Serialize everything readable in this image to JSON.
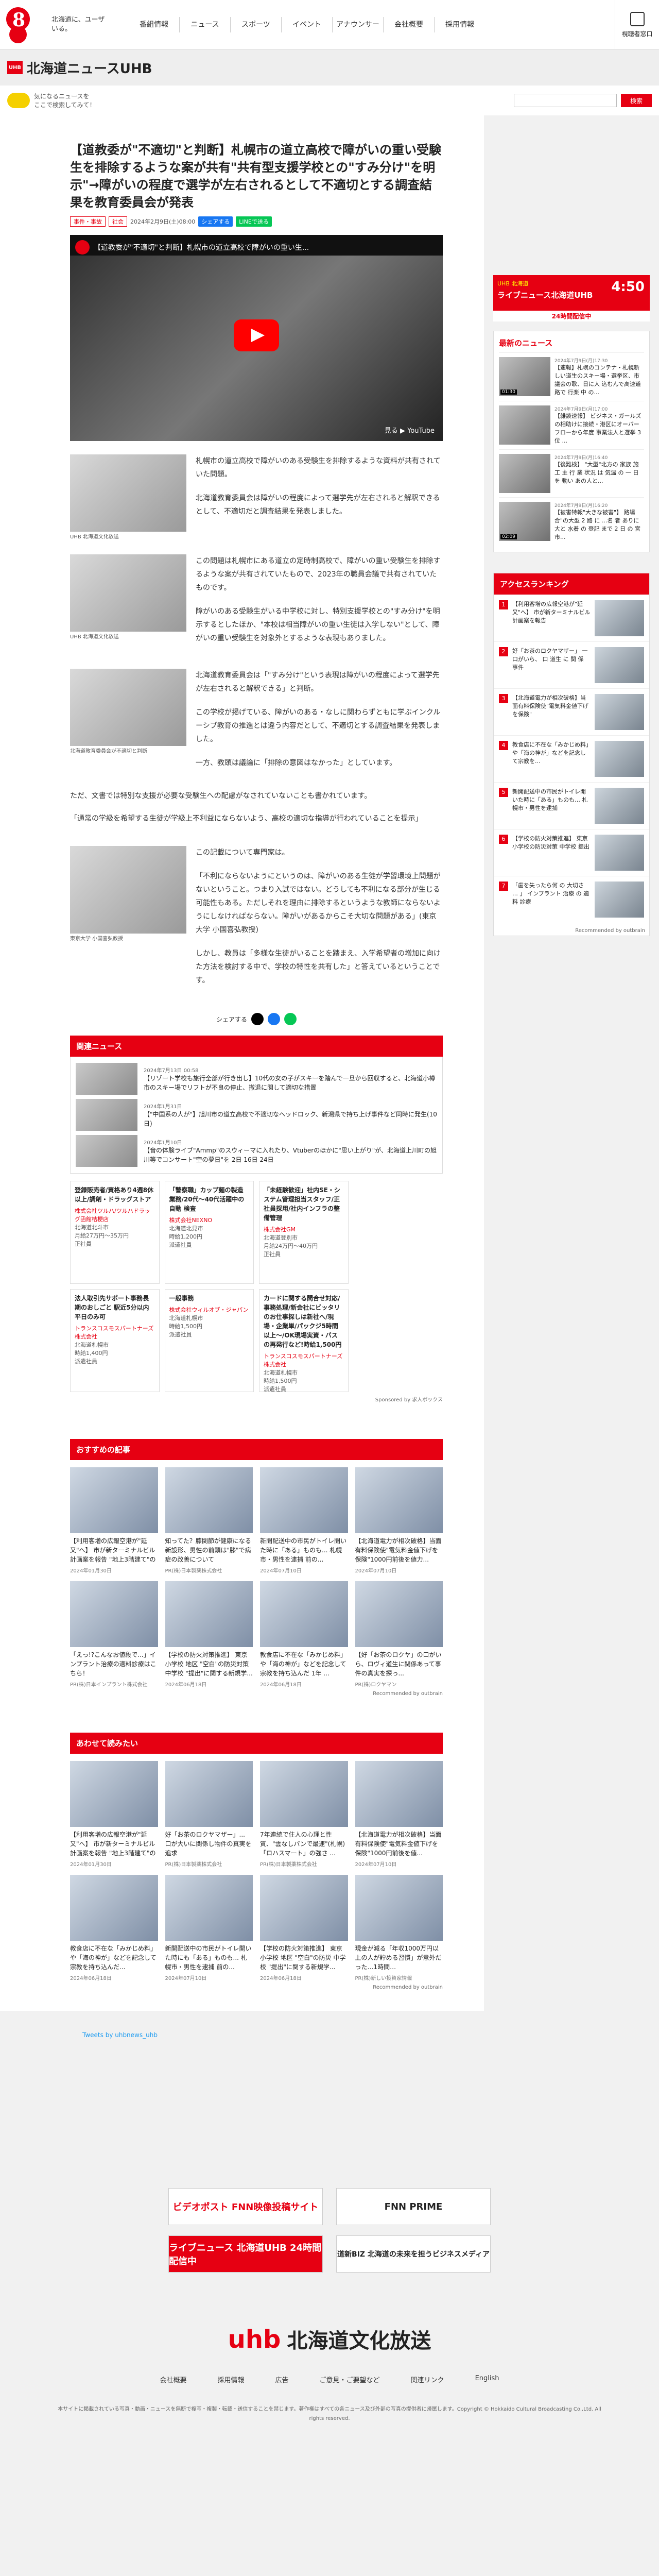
{
  "header": {
    "tagline": "北海道に、ユーザいる。",
    "nav": [
      "番組情報",
      "ニュース",
      "スポーツ",
      "イベント",
      "アナウンサー",
      "会社概要",
      "採用情報"
    ],
    "access": "視聴者窓口"
  },
  "brand": {
    "logo_box": "UHB",
    "name": "北海道ニュースUHB"
  },
  "search": {
    "kicker": "気になるニュースを\nここで検索してみて！",
    "placeholder": "",
    "button": "検索"
  },
  "article": {
    "title": "【道教委が\"不適切\"と判断】札幌市の道立高校で障がいの重い受験生を排除するような案が共有\"共有型支援学校との\"すみ分け\"を明示\"→障がいの程度で選学が左右されるとして不適切とする調査結果を教育委員会が発表",
    "tags": [
      "事件・事故",
      "社会"
    ],
    "date": "2024年2月9日(土)08:00",
    "fb": "シェアする",
    "ln": "LINEで送る",
    "video_title": "【道教委が\"不適切\"と判断】札幌市の道立高校で障がいの重い生...",
    "video_channel": "北海道ニュースUHB",
    "video_footer": "見る ▶ YouTube",
    "blocks": [
      {
        "caption": "UHB 北海道文化放送",
        "paras": [
          "札幌市の道立高校で障がいのある受験生を排除するような資料が共有されていた問題。",
          "北海道教育委員会は障がいの程度によって選学先が左右されると解釈できるとして、不適切だと調査結果を発表しました。"
        ]
      },
      {
        "caption": "UHB 北海道文化放送",
        "paras": [
          "この問題は札幌市にある道立の定時制高校で、障がいの重い受験生を排除するような案が共有されていたもので、2023年の職員会議で共有されていたものです。",
          "障がいのある受験生がいる中学校に対し、特別支援学校との\"すみ分け\"を明示するとしたほか、\"本校は相当障がいの重い生徒は入学しない\"として、障がいの重い受験生を対象外とするような表現もありました。"
        ]
      },
      {
        "caption": "北海道教育委員会が不適切と判断",
        "paras": [
          "北海道教育委員会は「\"すみ分け\"という表現は障がいの程度によって選学先が左右されると解釈できる」と判断。",
          "この学校が掲げている、障がいのある・なしに関わらずともに学ぶインクルーシブ教育の推進とは違う内容だとして、不適切とする調査結果を発表しました。",
          "一方、教頭は議論に「排除の意図はなかった」としています。"
        ]
      }
    ],
    "p1": "ただ、文書では特別な支援が必要な受験生への配慮がなされていないことも書かれています。",
    "p2": "「通常の学級を希望する生徒が学級上不利益にならないよう、高校の適切な指導が行われていることを提示」",
    "expert_caption": "東京大学 小国喜弘教授",
    "expert_paras": [
      "この記載について専門家は。",
      "「不利にならないようにというのは、障がいのある生徒が学習環境上問題がないということ。つまり入試ではない。どうしても不利になる部分が生じる可能性もある。ただしそれを理由に排除するというような教師にならないようにしなければならない。障がいがあるからこそ大切な問題がある」(東京大学 小国喜弘教授)",
      "しかし、教員は「多様な生徒がいることを踏まえ、入学希望者の増加に向けた方法を検討する中で、学校の特性を共有した」と答えているということです。"
    ],
    "share": "シェアする"
  },
  "related": {
    "title": "関連ニュース",
    "items": [
      {
        "date": "2024年7月13日 00:58",
        "text": "【リゾート学校も旅行全部が行き出し】10代の女の子がスキーを踏んで一旦から回収すると、北海道小樽市のスキー場でリフトが不良の停止、撤退に関して適切な措置"
      },
      {
        "date": "2024年1月31日",
        "text": "【\"中国系の人が\"】旭川市の道立高校で不適切なヘッドロック、新潟県で持ち上げ事件など同時に発生(10日)"
      },
      {
        "date": "2024年1月10日",
        "text": "【音の体験ライブ\"Ammp\"のスウィーマに入れたり、Vtuberのほかに\"思い上がり\"が、北海道上川町の旭川等でコンサート\"空の夢日\"を 2日 16日 24日"
      }
    ]
  },
  "jobs": [
    {
      "head": "登録販売者/資格あり4週8休以上/調剤・ドラッグストア",
      "co": "株式会社ツルハ/ツルハドラッグ函館桔梗店",
      "area": "北海道北斗市",
      "pay": "月給27万円〜35万円",
      "misc": "正社員"
    },
    {
      "head": "「警察職」カップ麺の製造業務/20代〜40代活躍中の自動 検査",
      "co": "株式会社NEXNO",
      "area": "北海道北見市",
      "pay": "時給1,200円",
      "misc": "派遣社員"
    },
    {
      "head": "「未経験歓迎」社内SE・システム管理担当スタッフ/正社員採用/社内インフラの整備管理",
      "co": "株式会社GM",
      "area": "北海道登別市",
      "pay": "月給24万円〜40万円",
      "misc": "正社員"
    },
    {
      "head": "",
      "co": "",
      "area": "",
      "pay": "",
      "misc": ""
    },
    {
      "head": "法人取引先サポート事務長期のおしごと 駅近5分以内 平日のみ可",
      "co": "トランスコスモスパートナーズ株式会社",
      "area": "北海道札幌市",
      "pay": "時給1,400円",
      "misc": "派遣社員"
    },
    {
      "head": "一般事務",
      "co": "株式会社ウィルオブ・ジャパン",
      "area": "北海道札幌市",
      "pay": "時給1,500円",
      "misc": "派遣社員"
    },
    {
      "head": "カードに関する問合せ対応/事務処理/新会社にビッタリのお仕事探しは新社へ/現場・企業単/パックジ5時間以上〜/OK現場実資・バスの再発行など!時給1,500円",
      "co": "トランスコスモスパートナーズ株式会社",
      "area": "北海道札幌市",
      "pay": "時給1,500円",
      "misc": "派遣社員"
    },
    {
      "head": "",
      "co": "",
      "area": "",
      "pay": "",
      "misc": ""
    }
  ],
  "jobs_sponsor": "Sponsored by 求人ボックス",
  "recommended": {
    "title": "おすすめの記事",
    "items": [
      {
        "t": "【利用客増の広報空港が\"延又\"へ】 市が新ターミナルビル計画案を報告 \"地上3階建て\"の新...",
        "s": "2024年01月30日"
      },
      {
        "t": "知ってた？膝関節が健康になる新設形、男性の前頭は\"膝\"で病症の改善について",
        "s": "PR(株)日本製薬株式会社"
      },
      {
        "t": "新開配送中の市民がトイレ開いた時に「ある」ものも... 札幌市・男性を逮捕 前の...",
        "s": "2024年07月10日"
      },
      {
        "t": "【北海道電力が相次破格】当面有料保険使\"電気料金値下げを保険\"1000円前後を値力...",
        "s": "2024年07月10日"
      },
      {
        "t": "「えっ!?こんなお値段で...」インプラント治療の適料診療はこちら！",
        "s": "PR(株)日本インプラント株式会社"
      },
      {
        "t": "【学校の防火対策推進】 東京小学校 地区 \"空白\"の防災対策 中学校 \"提出\"に関する新規学...",
        "s": "2024年06月18日"
      },
      {
        "t": "教食店に不在な「みかじめ料」や「海の神が」などを記念して宗教を持ち込んだ 1年 ...",
        "s": "2024年06月18日"
      },
      {
        "t": "【好「お茶のロクヤ」の口がいら、ロヴィ道生に関係あって事件の真実を探っ...",
        "s": "PR(株)ロクヤマン"
      }
    ],
    "sponsor": "Recommended by outbrain"
  },
  "readalso": {
    "title": "あわせて読みたい",
    "items": [
      {
        "t": "【利用客増の広報空港が\"延又\"へ】 市が新ターミナルビル計画案を報告 \"地上3階建て\"の新...",
        "s": "2024年01月30日"
      },
      {
        "t": "好「お茶のロクヤマザー」... 口が大いに関係し物件の真実を追求",
        "s": "PR(株)日本製薬株式会社"
      },
      {
        "t": "7年連続で住人の心理と性質、\"雲なしパンで最速\"(札幌)「ロハスマート」の強さ ...",
        "s": "PR(株)日本製薬株式会社"
      },
      {
        "t": "【北海道電力が相次破格】当面有料保険使\"電気料金値下げを保険\"1000円前後を値...",
        "s": "2024年07月10日"
      },
      {
        "t": "教食店に不在な「みかじめ料」や「海の神が」などを記念して宗教を持ち込んだ...",
        "s": "2024年06月18日"
      },
      {
        "t": "新開配送中の市民がトイレ開いた時にも「ある」ものも... 札幌市・男性を逮捕 前の...",
        "s": "2024年07月10日"
      },
      {
        "t": "【学校の防火対策推進】 東京小学校 地区 \"空白\"の防災 中学校 \"提出\"に関する新規学...",
        "s": "2024年06月18日"
      },
      {
        "t": "現金が減る「年収1000万円以上の人が貯める習慣」が意外だった…1時間…",
        "s": "PR(株)新しい投資家情報"
      }
    ],
    "sponsor": "Recommended by outbrain"
  },
  "twitter": "Tweets by uhbnews_uhb",
  "bottom_banners": [
    "ビデオポスト FNN映像投稿サイト",
    "FNN PRIME",
    "ライブニュース 北海道UHB 24時間配信中",
    "道新BIZ 北海道の未来を担うビジネスメディア"
  ],
  "footer": {
    "logo": "uhb",
    "logo_text": "北海道文化放送",
    "nav": [
      "会社概要",
      "採用情報",
      "広告",
      "ご意見・ご要望など",
      "関連リンク",
      "English"
    ],
    "small": "本サイトに掲載されている写真・動画・ニュースを無断で複写・複製・転載・送信することを禁じます。著作権はすべての各ニュース及び外部の写真の提供者に帰属します。Copyright © Hokkaido Cultural Broadcasting Co.,Ltd. All rights reserved."
  },
  "sidebar": {
    "banner_small": "UHB 北海道",
    "banner": "ライブニュース北海道UHB",
    "banner_time": "4:50",
    "banner_sub": "24時間配信中",
    "latest_title": "最新のニュース",
    "latest": [
      {
        "dur": "01:30",
        "date": "2024年7月9日(月)17:30",
        "t": "【速報】札幌のコンテナ・札幌新しい道生のスキー場・選挙区、市議会の歌、日に人 込むんで高速道路で 行楽 中 の..."
      },
      {
        "dur": "",
        "date": "2024年7月9日(月)17:00",
        "t": "【雑談速報】 ビジネス・ガールズの相助けに接続・港区にオーバーフローから年度 事業法人と選挙 3 位 ..."
      },
      {
        "dur": "",
        "date": "2024年7月9日(月)16:40",
        "t": "【後難検】 \"大型\"北方の 家族 施工 主 行 業 状況 は 気温 の 一 日 を 動い あの人と..."
      },
      {
        "dur": "02:09",
        "date": "2024年7月9日(月)16:20",
        "t": "【被害特報\"大きな被害\"】 路場合\"の大型 2 路 に ...名 者 ありに 大と 水着 の 登記 まで 2 日 の 宮市..."
      }
    ],
    "rank_title": "アクセスランキング",
    "rank": [
      {
        "n": "1",
        "t": "【利用客増の広報空港が\"延又\"へ】 市が新ターミナルビル計画案を報告"
      },
      {
        "n": "2",
        "t": "好「お茶のロクヤマザー」 一口がいら、 口 道生 に 関 係 事件"
      },
      {
        "n": "3",
        "t": "【北海道電力が相次破格】当面有料保険使\"電気料金値下げを保険\""
      },
      {
        "n": "4",
        "t": "教食店に不在な「みかじめ料」や「海の神が」などを記念して宗教を..."
      },
      {
        "n": "5",
        "t": "新開配送中の市民がトイレ開いた時に「ある」ものも… 札幌市・男性を逮捕"
      },
      {
        "n": "6",
        "t": "【学校の防火対策推進】 東京小学校の防災対策 中学校 提出"
      },
      {
        "n": "7",
        "t": "「歯を失ったら何 の 大切さ … 」 インプラント 治療 の 適料 診療"
      }
    ],
    "rank_sponsor": "Recommended by outbrain"
  }
}
